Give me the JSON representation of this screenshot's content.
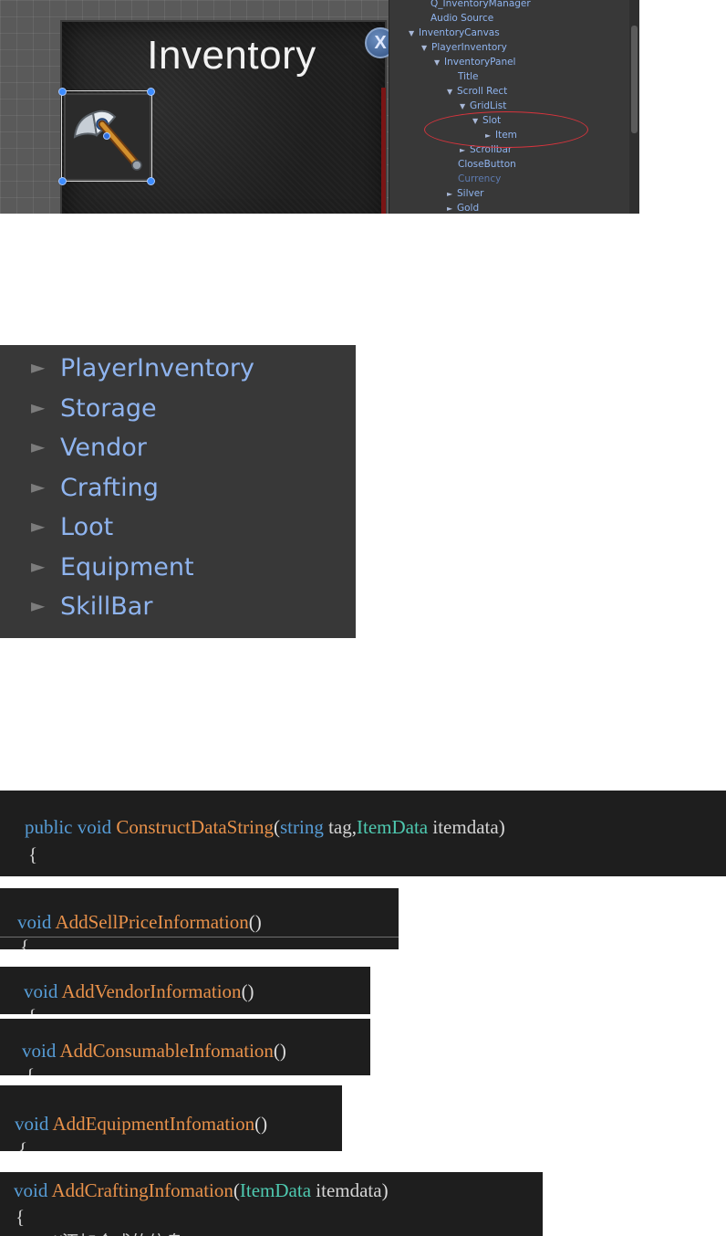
{
  "scene": {
    "panel_title": "Inventory",
    "close_label": "X",
    "item_icon": "axe-icon"
  },
  "hierarchy_small": {
    "rows": [
      {
        "label": "Q_InventoryManager",
        "indent": 0,
        "arrow": ""
      },
      {
        "label": "Audio Source",
        "indent": 0,
        "arrow": ""
      },
      {
        "label": "InventoryCanvas",
        "indent": 0,
        "arrow": "▼"
      },
      {
        "label": "PlayerInventory",
        "indent": 1,
        "arrow": "▼"
      },
      {
        "label": "InventoryPanel",
        "indent": 2,
        "arrow": "▼"
      },
      {
        "label": "Title",
        "indent": 3,
        "arrow": ""
      },
      {
        "label": "Scroll Rect",
        "indent": 3,
        "arrow": "▼"
      },
      {
        "label": "GridList",
        "indent": 4,
        "arrow": "▼"
      },
      {
        "label": "Slot",
        "indent": 5,
        "arrow": "▼"
      },
      {
        "label": "Item",
        "indent": 6,
        "arrow": "►"
      },
      {
        "label": "Scrollbar",
        "indent": 4,
        "arrow": "►"
      },
      {
        "label": "CloseButton",
        "indent": 3,
        "arrow": ""
      },
      {
        "label": "Currency",
        "indent": 3,
        "arrow": "",
        "dim": true
      },
      {
        "label": "Silver",
        "indent": 3,
        "arrow": "►"
      },
      {
        "label": "Gold",
        "indent": 3,
        "arrow": "►"
      }
    ]
  },
  "hierarchy_zoom": {
    "rows": [
      "PlayerInventory",
      "Storage",
      "Vendor",
      "Crafting",
      "Loot",
      "Equipment",
      "SkillBar"
    ],
    "arrow": "►"
  },
  "code": {
    "snippet1": {
      "kw_public": "public",
      "kw_void": "void",
      "fn": "ConstructDataString",
      "open": "(",
      "kw_string": "string",
      "p1": "tag",
      "comma": ",",
      "type": "ItemData",
      "p2": "itemdata",
      "close": ")",
      "brace": "{"
    },
    "snippet2": {
      "kw": "void",
      "fn": "AddSellPriceInformation",
      "parens": "()",
      "brace": "{"
    },
    "snippet3": {
      "kw": "void",
      "fn": "AddVendorInformation",
      "parens": "()",
      "brace": "{"
    },
    "snippet4": {
      "kw": "void",
      "fn": "AddConsumableInfomation",
      "parens": "()",
      "brace": "{"
    },
    "snippet5": {
      "kw": "void",
      "fn": "AddEquipmentInfomation",
      "parens": "()",
      "brace": "{"
    },
    "snippet6": {
      "kw": "void",
      "fn": "AddCraftingInfomation",
      "open": "(",
      "type": "ItemData",
      "param": "itemdata",
      "close": ")",
      "brace": "{",
      "comment": "//添加合成的信息"
    }
  },
  "colors": {
    "keyword": "#569cd6",
    "function": "#e8914a",
    "type": "#4ec9b0",
    "identifier": "#d4d4d4",
    "hierarchy_text": "#8fb4ef",
    "highlight_ellipse": "#d8343d"
  }
}
